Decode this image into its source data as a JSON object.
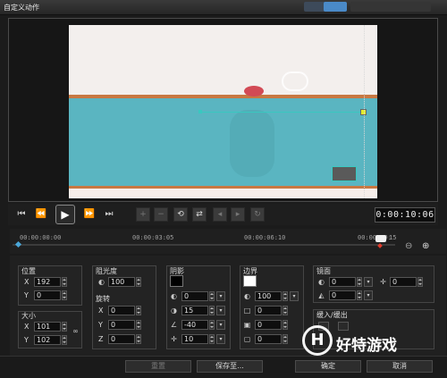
{
  "window": {
    "title": "自定义动作"
  },
  "transport": {
    "timecode": "0:00:10:06",
    "icons": [
      "skip-start",
      "step-back",
      "play",
      "step-forward",
      "skip-end"
    ]
  },
  "keyframe_tools": [
    "add",
    "remove",
    "reverse",
    "swap",
    "prev",
    "next"
  ],
  "ruler": {
    "ticks": [
      "00:00:00:00",
      "00:00:03:05",
      "00:00:06:10",
      "00:00:09:",
      "15"
    ]
  },
  "position": {
    "label": "位置",
    "x": "192",
    "y": "0"
  },
  "size": {
    "label": "大小",
    "x": "101",
    "y": "102"
  },
  "opacity": {
    "label": "阻光度",
    "value": "100"
  },
  "rotation": {
    "label": "旋转",
    "x": "0",
    "y": "0",
    "z": "0"
  },
  "shadow": {
    "label": "阴影",
    "v1": "0",
    "v2": "15",
    "v3": "-40",
    "v4": "10",
    "color": "#000000"
  },
  "border": {
    "label": "边界",
    "v1": "100",
    "v2": "0",
    "v3": "0",
    "v4": "0",
    "color": "#ffffff"
  },
  "mirror": {
    "label": "镜面",
    "v1": "0",
    "v2": "0",
    "v3": "0"
  },
  "fade": {
    "label": "缓入/缓出"
  },
  "buttons": {
    "reset": "重置",
    "save_to": "保存至...",
    "ok": "确定",
    "cancel": "取消"
  },
  "watermark": {
    "text": "好特游戏"
  },
  "colors": {
    "accent": "#39c8c0",
    "stripe": "#c87842",
    "water": "#5ab5c1"
  }
}
